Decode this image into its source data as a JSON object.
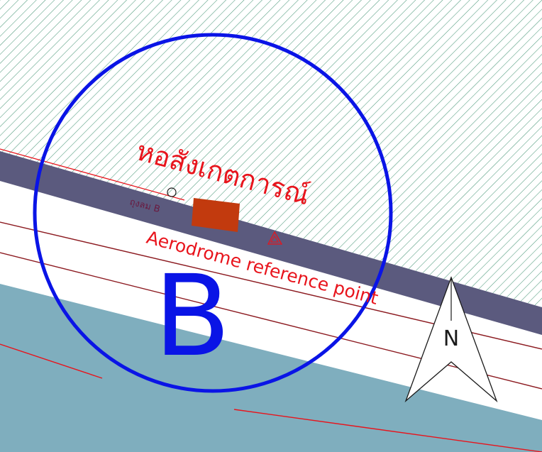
{
  "map": {
    "zone_label": "B",
    "tower_label_thai": "หอสังเกตการณ์",
    "windsock_label": "ถุงลม B",
    "arp_label": "Aerodrome reference point",
    "north_label": "N"
  },
  "colors": {
    "hatch_green": "#4f9a7c",
    "apron_band": "#5b5a7e",
    "water_area": "#7faebe",
    "circle_stroke": "#0a14e6",
    "tower_fill": "#c23a0e",
    "label_red": "#e8141c",
    "line_dark_red": "#8c1a20",
    "line_red": "#e8141c",
    "windsock_text": "#6a1a40"
  },
  "icons": {
    "arp_marker": "triangle-marker-icon",
    "windsock_marker": "circle-marker-icon",
    "north_arrow": "north-arrow-icon"
  }
}
